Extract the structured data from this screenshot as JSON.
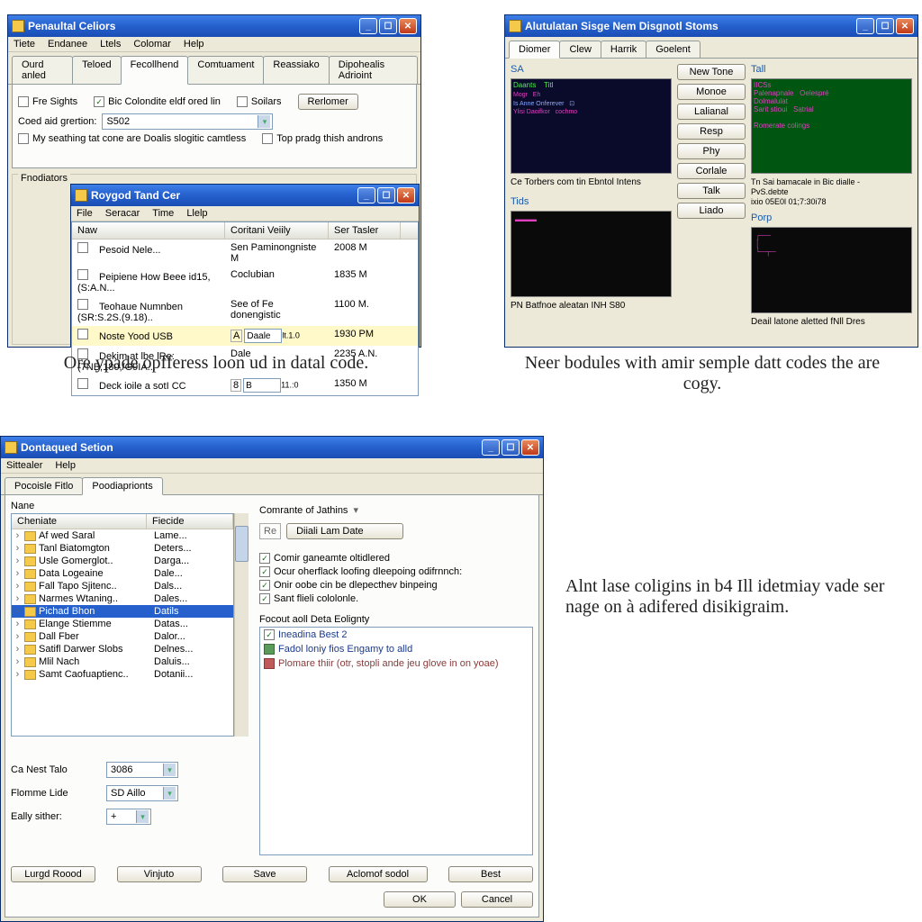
{
  "window1": {
    "title": "Penaultal Celiors",
    "menu": [
      "Tiete",
      "Endanee",
      "Ltels",
      "Colomar",
      "Help"
    ],
    "tabs": [
      "Ourd anled",
      "Teloed",
      "Fecollhend",
      "Comtuament",
      "Reassiako",
      "Dipohealis Adrioint"
    ],
    "active_tab": 2,
    "chk_fre": "Fre Sights",
    "chk_bic": "Bic Colondite eldf ored lin",
    "chk_bic_checked": true,
    "chk_soilars": "Soilars",
    "btn_rerlomer": "Rerlomer",
    "lbl_coed": "Coed aid grertion:",
    "val_coed": "S502",
    "chk_my": "My seathing tat cone are Doalis slogitic camtless",
    "chk_top": "Top pradg thish androns",
    "group_fnod": "Fnodiators"
  },
  "window1b": {
    "title": "Roygod Tand Cer",
    "menu": [
      "File",
      "Seracar",
      "Time",
      "Llelp"
    ],
    "cols": [
      "Naw",
      "Coritani Veiily",
      "Ser Tasler"
    ],
    "rows": [
      {
        "n": "Pesoid Nele...",
        "c": "Sen Paminongniste M",
        "s": "2008 M"
      },
      {
        "n": "Peipiene How Beee id15, (S:A.N...",
        "c": "Coclubian",
        "s": "1835 M"
      },
      {
        "n": "Teohaue Numnben (SR:S.2S.(9.18)..",
        "c": "See of Fe donengistic",
        "s": "1100 M."
      },
      {
        "n": "Noste Yood USB",
        "c": "Daale",
        "cv": "lt.1.0",
        "s": "1930 PM"
      },
      {
        "n": "Dekim at lbe lRe: (7NB;180,/G9IA...",
        "c": "Dale",
        "s": "2235 A.N."
      },
      {
        "n": "Deck ioile a sotI CC",
        "c": "B",
        "cv": "11.:0",
        "s": "1350 M"
      }
    ]
  },
  "caption1": "Ore ypade opfferess loon ud in datal code.",
  "window2": {
    "title": "Alutulatan Sisge Nem Disgnotl Stoms",
    "tabs": [
      "Diomer",
      "Clew",
      "Harrik",
      "Goelent"
    ],
    "active_tab": 0,
    "buttons": [
      "New Tone",
      "Monoe",
      "Lalianal",
      "Resp",
      "Phy",
      "Corlale",
      "Talk",
      "Liado"
    ],
    "label_sa": "SA",
    "label_tall": "Tall",
    "thumb1_caption": "Ce Torbers com tin Ebntol Intens",
    "thumb2_lines": [
      "Tn Sai bamacale in Bic dialle -",
      "PvS.debte",
      "ixio 05E0l 01;7:30i78"
    ],
    "label_tids": "Tids",
    "thumb3_caption": "PN Batfnoe aleatan INH S80",
    "label_pop": "Porp",
    "thumb4_caption": "Deail latone aletted fNll Dres"
  },
  "caption2": "Neer bodules with amir semple datt codes the are cogy.",
  "window3": {
    "title": "Dontaqued Setion",
    "menu": [
      "Sittealer",
      "Help"
    ],
    "tabs": [
      "Pocoisle Fitlo",
      "Poodiaprionts"
    ],
    "active_tab": 1,
    "lbl_nane": "Nane",
    "tree_cols": [
      "Cheniate",
      "Fiecide"
    ],
    "tree_rows": [
      {
        "n": "Af wed Saral",
        "f": "Lame..."
      },
      {
        "n": "Tanl Biatomgton",
        "f": "Deters..."
      },
      {
        "n": "Usle Gomerglot..",
        "f": "Darga..."
      },
      {
        "n": "Data Logeaine",
        "f": "Dale..."
      },
      {
        "n": "Fall Tapo Sjitenc..",
        "f": "Dals..."
      },
      {
        "n": "Narmes Wtaning..",
        "f": "Dales..."
      },
      {
        "n": "Pichad Bhon",
        "f": "Datils",
        "sel": true
      },
      {
        "n": "Elange Stiemme",
        "f": "Datas..."
      },
      {
        "n": "Dall Fber",
        "f": "Dalor..."
      },
      {
        "n": "Satifl Darwer Slobs",
        "f": "Delnes..."
      },
      {
        "n": "Mlil Nach",
        "f": "Daluis..."
      },
      {
        "n": "Samt Caofuaptienc..",
        "f": "Dotanii..."
      }
    ],
    "lbl_dropdown": "Comrante of Jathins",
    "btn_field": "Diiali Lam Date",
    "btn_field_prefix": "Re",
    "chk1": "Comir ganeamte oltidlered",
    "chk2": "Ocur oherflack loofing dleepoing odifrnnch:",
    "chk3": "Onir oobe cin be dlepecthev binpeing",
    "chk4": "Sant flieli cololonle.",
    "group_focout": "Focout aoll Deta Eolignty",
    "link1": "Ineadina Best 2",
    "link2": "Fadol loniy fios Engamy to alld",
    "link3": "Plomare thiir (otr, stopli ande jeu glove in on yoae)",
    "lbl_canest": "Ca Nest Talo",
    "val_canest": "3086",
    "lbl_flomme": "Flomme Lide",
    "val_flomme": "SD Aillo",
    "lbl_eally": "Eally sither:",
    "val_eally": "+",
    "btn_lurgd": "Lurgd Roood",
    "btn_vinjuto": "Vinjuto",
    "btn_save": "Save",
    "btn_aclomof": "Aclomof sodol",
    "btn_best": "Best",
    "btn_ok": "OK",
    "btn_cancel": "Cancel"
  },
  "caption3": "Alnt lase coligins in b4 Ill idetmiay vade ser nage on à adifered disikigraim."
}
